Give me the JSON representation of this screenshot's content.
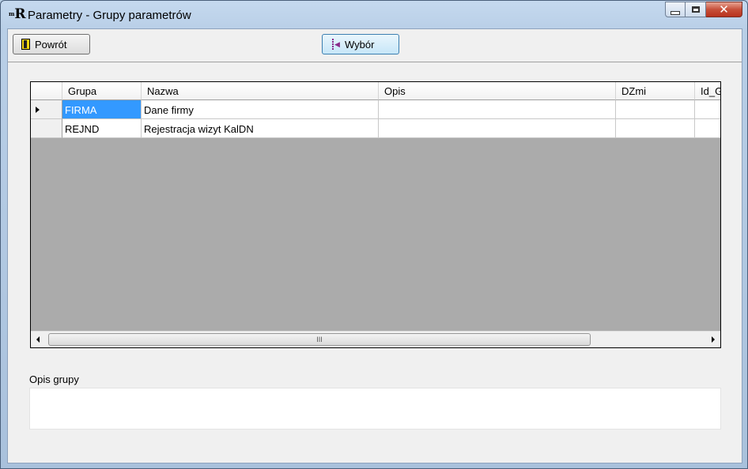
{
  "window": {
    "title": "Parametry - Grupy parametrów",
    "icon_letter": "R",
    "icon_prefix": "m"
  },
  "toolbar": {
    "back_label": "Powrót",
    "select_label": "Wybór"
  },
  "grid": {
    "columns": [
      "Grupa",
      "Nazwa",
      "Opis",
      "DZmi",
      "Id_G"
    ],
    "rows": [
      {
        "grupa": "FIRMA",
        "nazwa": "Dane firmy",
        "opis": "",
        "dzmi": "",
        "idg": "",
        "current": true
      },
      {
        "grupa": "REJND",
        "nazwa": "Rejestracja wizyt KalDN",
        "opis": "",
        "dzmi": "",
        "idg": "",
        "current": false
      }
    ],
    "selected_cell_color": "#3399ff",
    "scroll_grip": "III"
  },
  "description": {
    "label": "Opis grupy",
    "value": ""
  }
}
